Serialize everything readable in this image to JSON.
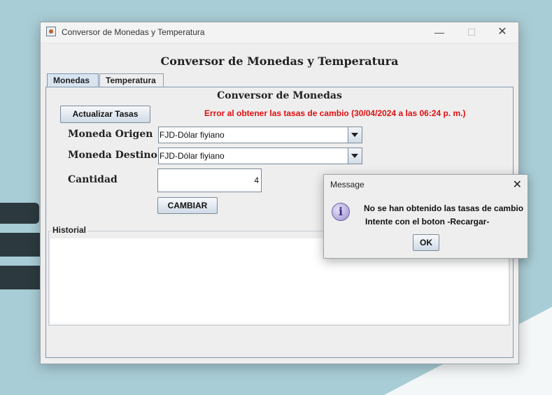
{
  "window": {
    "title": "Conversor de Monedas y Temperatura",
    "controls": {
      "minimize": "—",
      "maximize": "☐",
      "close": "✕"
    }
  },
  "app": {
    "heading": "Conversor de Monedas y Temperatura"
  },
  "tabs": [
    {
      "label": "Monedas",
      "active": true
    },
    {
      "label": "Temperatura",
      "active": false
    }
  ],
  "currency_panel": {
    "title": "Conversor de Monedas",
    "update_button": "Actualizar Tasas",
    "error_message": "Error al obtener las tasas de cambio (30/04/2024 a las 06:24 p. m.)",
    "origin_label": "Moneda Origen",
    "origin_value": "FJD-Dólar fiyiano",
    "destination_label": "Moneda Destino",
    "destination_value": "FJD-Dólar fiyiano",
    "amount_label": "Cantidad",
    "amount_value": "4",
    "convert_button": "CAMBIAR",
    "history_label": "Historial"
  },
  "dialog": {
    "title": "Message",
    "close": "✕",
    "icon": "info-icon",
    "line1": "No se han obtenido las tasas de cambio",
    "line2": "Intente con el boton -Recargar-",
    "ok_button": "OK"
  },
  "colors": {
    "error": "#e01010",
    "desktop": "#a9cdd6"
  }
}
